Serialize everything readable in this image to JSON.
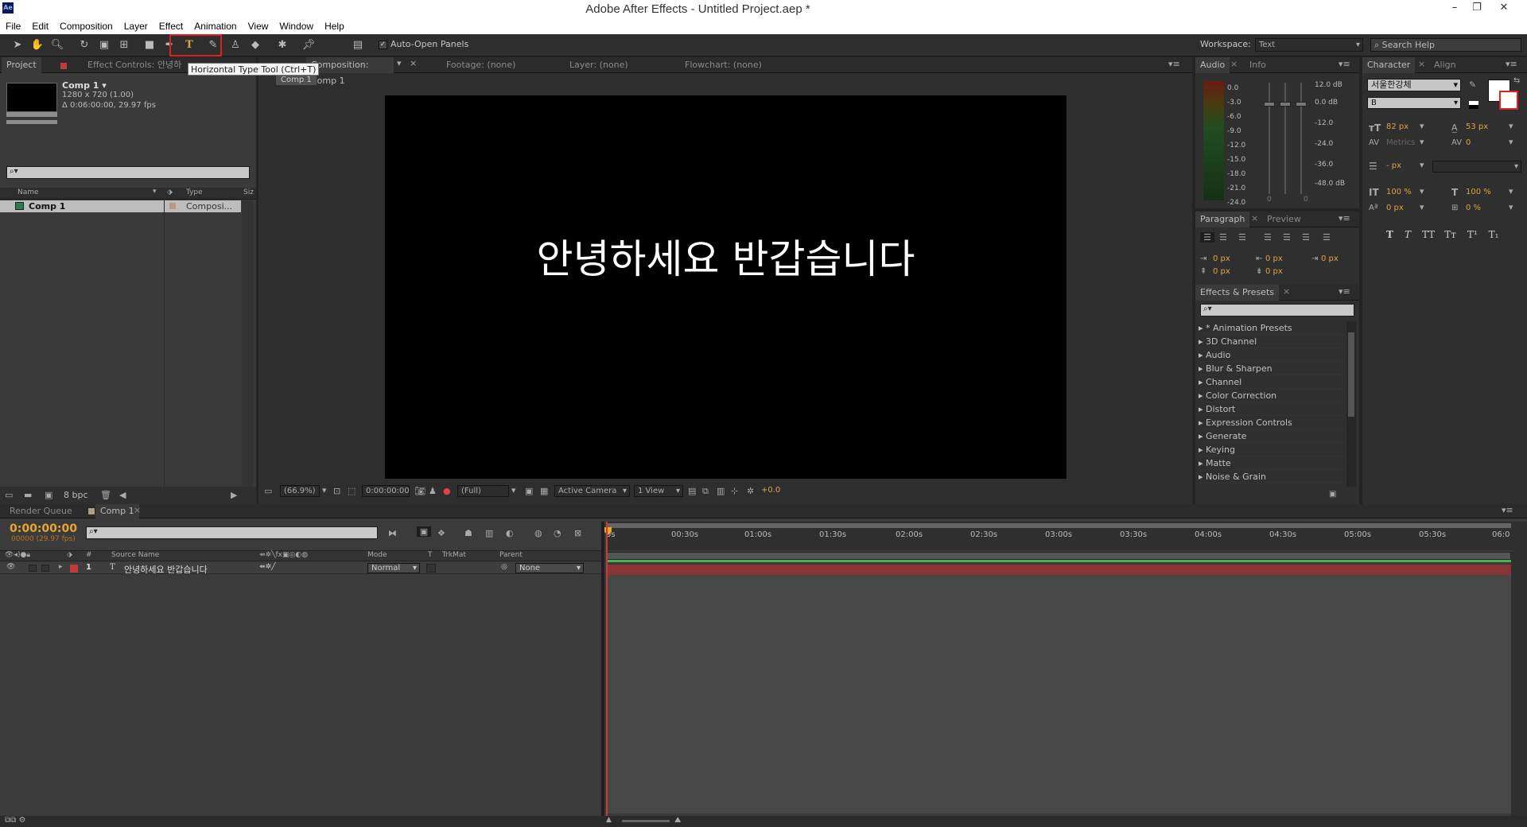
{
  "app": {
    "logo": "Ae",
    "title": "Adobe After Effects - Untitled Project.aep *",
    "window_buttons": [
      "–",
      "❐",
      "✕"
    ]
  },
  "menu": [
    "File",
    "Edit",
    "Composition",
    "Layer",
    "Effect",
    "Animation",
    "View",
    "Window",
    "Help"
  ],
  "toolbar": {
    "auto_open_label": "Auto-Open Panels",
    "tooltip": "Horizontal Type Tool (Ctrl+T)",
    "workspace_label": "Workspace:",
    "workspace_value": "Text",
    "search_placeholder": "Search Help"
  },
  "project": {
    "tab": "Project",
    "tab2": "Effect Controls: 안녕하",
    "comp_name": "Comp 1 ▾",
    "comp_dims": "1280 x 720 (1.00)",
    "comp_duration": "Δ 0:06:00:00, 29.97 fps",
    "columns": {
      "name": "Name",
      "type": "Type",
      "size": "Siz"
    },
    "item": {
      "name": "Comp 1",
      "type": "Composi..."
    },
    "bpc": "8 bpc"
  },
  "viewer": {
    "tabs": [
      "Composition: Comp 1",
      "Footage: (none)",
      "Layer: (none)",
      "Flowchart: (none)"
    ],
    "comp_chip": "Comp 1",
    "canvas_text": "안녕하세요 반갑습니다",
    "zoom": "(66.9%)",
    "timecode": "0:00:00:00",
    "resolution": "(Full)",
    "camera": "Active Camera",
    "view": "1 View",
    "exposure": "+0.0"
  },
  "audio": {
    "tabs": [
      "Audio",
      "Info"
    ],
    "left_scale": [
      "0.0",
      "-3.0",
      "-6.0",
      "-9.0",
      "-12.0",
      "-15.0",
      "-18.0",
      "-21.0",
      "-24.0"
    ],
    "right_scale": [
      "12.0 dB",
      "0.0 dB",
      "-12.0",
      "-24.0",
      "-36.0",
      "-48.0 dB"
    ],
    "fader_values": [
      "0",
      "0"
    ]
  },
  "paragraph": {
    "tabs": [
      "Paragraph",
      "Preview"
    ],
    "indent": [
      "0 px",
      "0 px",
      "0 px",
      "0 px",
      "0 px"
    ]
  },
  "effects": {
    "tab": "Effects & Presets",
    "items": [
      "* Animation Presets",
      "3D Channel",
      "Audio",
      "Blur & Sharpen",
      "Channel",
      "Color Correction",
      "Distort",
      "Expression Controls",
      "Generate",
      "Keying",
      "Matte",
      "Noise & Grain"
    ]
  },
  "character": {
    "tabs": [
      "Character",
      "Align"
    ],
    "font": "서울한강체",
    "style": "B",
    "size": "82 px",
    "leading": "53 px",
    "kerning": "Metrics",
    "tracking": "0",
    "stroke": "- px",
    "vscale": "100 %",
    "hscale": "100 %",
    "baseline": "0 px",
    "tsume": "0 %",
    "styles": [
      "T",
      "T",
      "TT",
      "Tт",
      "T¹",
      "T₁"
    ]
  },
  "timeline": {
    "tabs": [
      "Render Queue",
      "Comp 1"
    ],
    "timecode": "0:00:00:00",
    "frames": "00000 (29.97 fps)",
    "columns": {
      "num": "#",
      "source": "Source Name",
      "mode": "Mode",
      "t": "T",
      "trkmat": "TrkMat",
      "parent": "Parent"
    },
    "ruler": [
      "0s",
      "00:30s",
      "01:00s",
      "01:30s",
      "02:00s",
      "02:30s",
      "03:00s",
      "03:30s",
      "04:00s",
      "04:30s",
      "05:00s",
      "05:30s",
      "06:0"
    ],
    "layer": {
      "num": "1",
      "name": "안녕하세요 반갑습니다",
      "mode": "Normal",
      "parent": "None"
    }
  },
  "colors": {
    "accent_orange": "#d9a441",
    "layer_red": "#8a3535",
    "work_green": "#4caf50",
    "label_red": "#c23b3b"
  }
}
